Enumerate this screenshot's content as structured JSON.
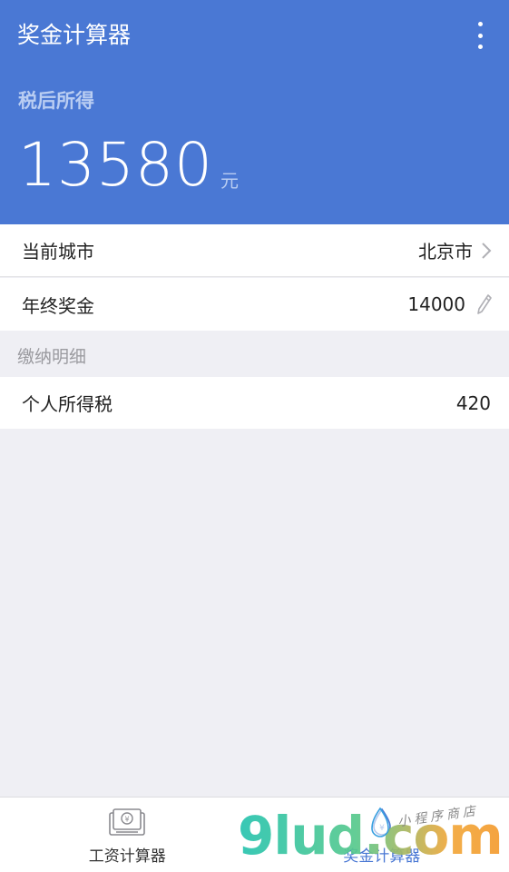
{
  "header": {
    "title": "奖金计算器",
    "after_tax_label": "税后所得",
    "amount": "13580",
    "unit": "元"
  },
  "rows": {
    "city": {
      "label": "当前城市",
      "value": "北京市"
    },
    "bonus": {
      "label": "年终奖金",
      "value": "14000"
    }
  },
  "details": {
    "section_label": "缴纳明细",
    "tax": {
      "label": "个人所得税",
      "value": "420"
    }
  },
  "tabbar": {
    "tabs": [
      {
        "label": "工资计算器",
        "icon": "salary-calculator-icon",
        "active": false
      },
      {
        "label": "奖金计算器",
        "icon": "bonus-calculator-icon",
        "active": true
      }
    ]
  },
  "watermark": {
    "text": "9lud.com",
    "sub": "小程序商店"
  },
  "colors": {
    "primary": "#4a78d4",
    "background": "#efeff4",
    "muted": "#b9cdf2"
  }
}
